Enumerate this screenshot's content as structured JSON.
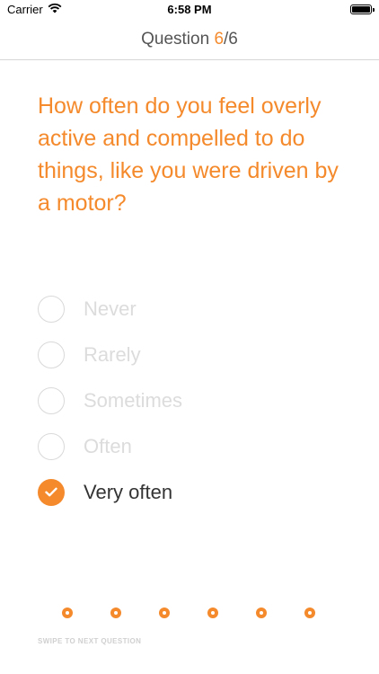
{
  "status_bar": {
    "carrier": "Carrier",
    "time": "6:58 PM",
    "wifi_icon": "wifi-icon",
    "battery_icon": "battery-icon"
  },
  "nav": {
    "prefix": "Question ",
    "current": "6",
    "separator": "/",
    "total": "6"
  },
  "question": {
    "text": "How often do you feel overly active and compelled to do things, like you were driven by a motor?"
  },
  "options": [
    {
      "label": "Never",
      "selected": false
    },
    {
      "label": "Rarely",
      "selected": false
    },
    {
      "label": "Sometimes",
      "selected": false
    },
    {
      "label": "Often",
      "selected": false
    },
    {
      "label": "Very often",
      "selected": true
    }
  ],
  "pager": {
    "count": 6
  },
  "hint": "SWIPE TO NEXT QUESTION",
  "colors": {
    "accent": "#f48a2c",
    "inactive": "#dcdcdc"
  }
}
